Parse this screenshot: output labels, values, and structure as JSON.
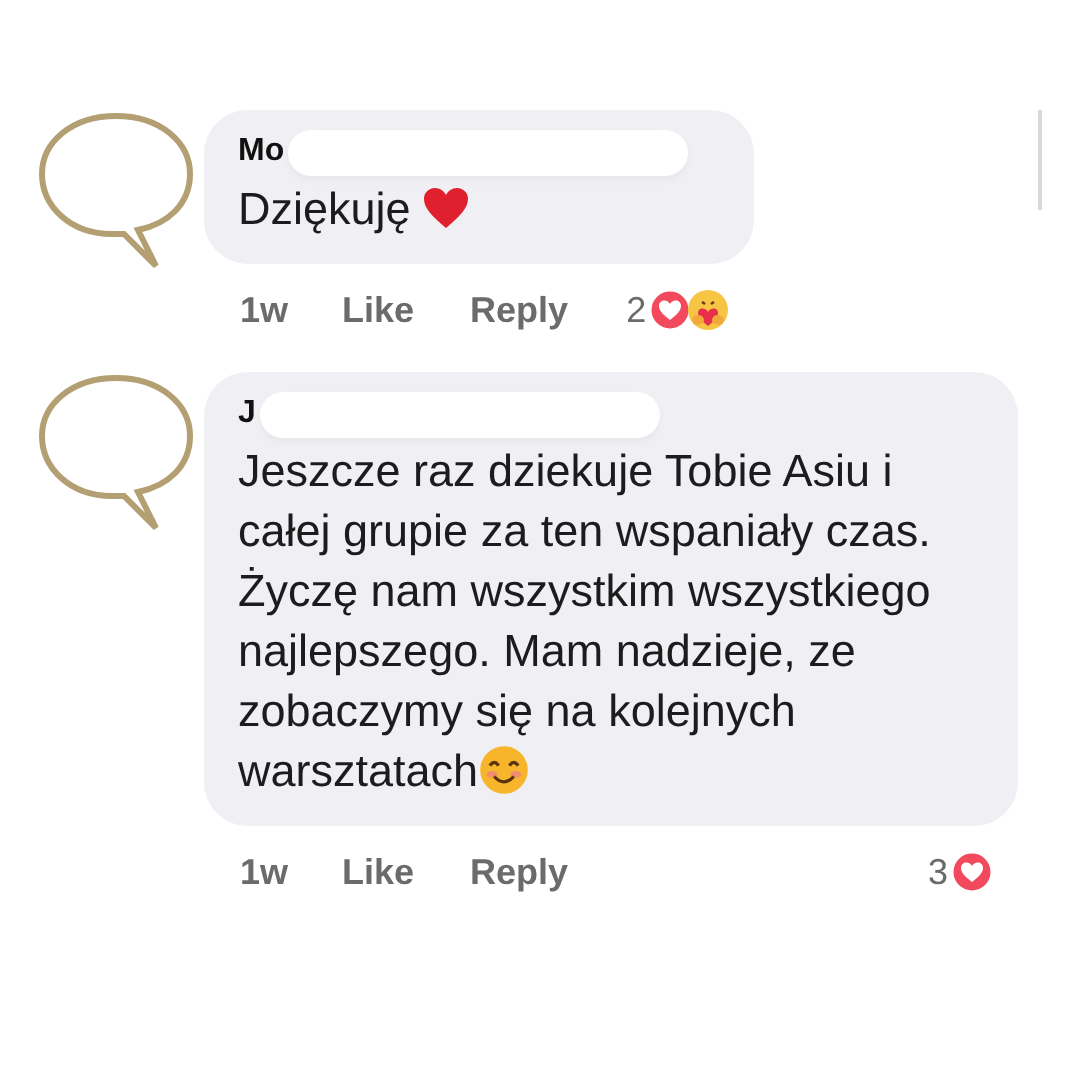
{
  "comments": [
    {
      "author": "Mo",
      "text": "Dziękuję",
      "trailing_emoji": {
        "kind": "heart"
      },
      "time": "1w",
      "like": "Like",
      "reply": "Reply",
      "reaction_count": "2",
      "reactions": [
        {
          "kind": "love"
        },
        {
          "kind": "care"
        }
      ]
    },
    {
      "author": "J",
      "text": "Jeszcze raz dziekuje Tobie Asiu i całej grupie za ten wspaniały czas. Życzę nam wszystkim wszystkiego najlepszego. Mam nadzieje, ze zobaczymy się na kolejnych warsztatach",
      "trailing_emoji": {
        "kind": "smile"
      },
      "time": "1w",
      "like": "Like",
      "reply": "Reply",
      "reaction_count": "3",
      "reactions": [
        {
          "kind": "love"
        }
      ]
    }
  ]
}
